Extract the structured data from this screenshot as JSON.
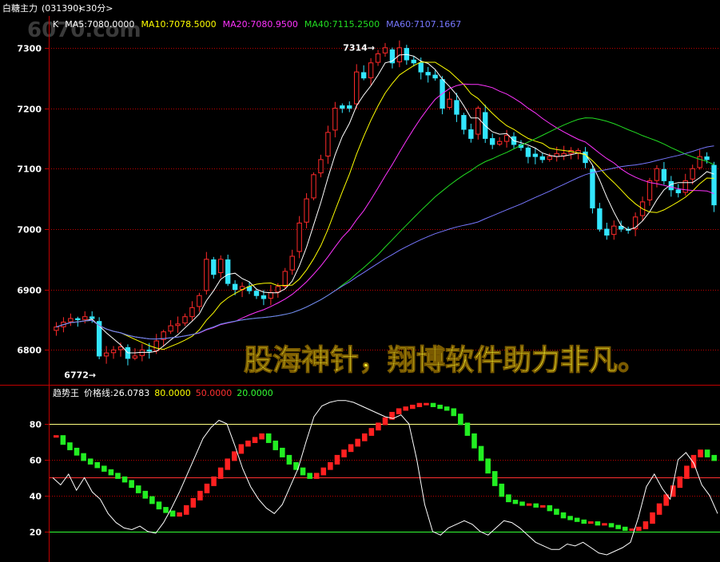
{
  "header": {
    "instrument": "白糖主力",
    "code": "(031390)",
    "period": "<30分>"
  },
  "watermark": "6070.com",
  "overlay_slogan": "股海神针，翔博软件助力非凡。",
  "colors": {
    "background": "#000000",
    "up": "#ff2a2a",
    "down": "#33e6ff",
    "grid": "#c00000",
    "ma5": "#ffffff",
    "ma10": "#ffff00",
    "ma20": "#ff33ff",
    "ma40": "#22dd22",
    "ma60": "#7777ff",
    "trend_up": "#ff2020",
    "trend_down": "#22ee22",
    "price_line": "#ffffff"
  },
  "chart_data": [
    {
      "type": "candlestick",
      "name": "K",
      "y_ticks": [
        7300,
        7200,
        7100,
        7000,
        6900,
        6800
      ],
      "ylim": [
        6745,
        7350
      ],
      "grid": true,
      "annotations": [
        {
          "text": "7314→",
          "bar": 45,
          "value": 7314
        },
        {
          "text": "6772→",
          "bar": 6,
          "value": 6772
        }
      ],
      "legend": [
        {
          "key": "K",
          "text": "K"
        },
        {
          "key": "ma5",
          "text": "MA5:7080.0000"
        },
        {
          "key": "ma10",
          "text": "MA10:7078.5000"
        },
        {
          "key": "ma20",
          "text": "MA20:7080.9500"
        },
        {
          "key": "ma40",
          "text": "MA40:7115.2500"
        },
        {
          "key": "ma60",
          "text": "MA60:7107.1667"
        }
      ],
      "closes": [
        6838,
        6846,
        6852,
        6850,
        6855,
        6852,
        6790,
        6795,
        6800,
        6805,
        6786,
        6790,
        6800,
        6798,
        6815,
        6830,
        6840,
        6843,
        6855,
        6870,
        6890,
        6950,
        6925,
        6950,
        6910,
        6900,
        6905,
        6898,
        6890,
        6885,
        6895,
        6905,
        6930,
        6955,
        7010,
        7050,
        7090,
        7115,
        7160,
        7200,
        7200,
        7200,
        7260,
        7250,
        7275,
        7290,
        7300,
        7275,
        7300,
        7280,
        7275,
        7260,
        7255,
        7250,
        7200,
        7215,
        7190,
        7165,
        7150,
        7200,
        7150,
        7140,
        7145,
        7155,
        7140,
        7135,
        7120,
        7120,
        7115,
        7120,
        7125,
        7125,
        7130,
        7130,
        7110,
        7035,
        7000,
        6990,
        7005,
        7000,
        6998,
        7020,
        7045,
        7080,
        7100,
        7080,
        7065,
        7060,
        7080,
        7100,
        7120,
        7115,
        7040
      ]
    },
    {
      "type": "line+bar",
      "name": "趋势王",
      "legend": [
        {
          "key": "name",
          "text": "趋势王"
        },
        {
          "key": "price",
          "text": "价格线:26.0783"
        },
        {
          "key": "l80",
          "text": "80.0000"
        },
        {
          "key": "l50",
          "text": "50.0000"
        },
        {
          "key": "l20",
          "text": "20.0000"
        }
      ],
      "y_ticks": [
        80,
        60,
        40,
        20
      ],
      "ylim": [
        3,
        100
      ],
      "levels": [
        80,
        50,
        20
      ],
      "trend_values": [
        73,
        69,
        66,
        63,
        60,
        58,
        56,
        54,
        52,
        50,
        48,
        45,
        42,
        39,
        36,
        33,
        31,
        29,
        30,
        34,
        38,
        42,
        46,
        50,
        55,
        60,
        64,
        68,
        70,
        72,
        74,
        70,
        66,
        62,
        58,
        55,
        52,
        50,
        52,
        55,
        58,
        62,
        65,
        68,
        71,
        74,
        77,
        80,
        83,
        86,
        88,
        89,
        90,
        91,
        91,
        90,
        89,
        88,
        85,
        80,
        74,
        67,
        60,
        53,
        46,
        40,
        37,
        36,
        35,
        35,
        34,
        34,
        32,
        30,
        28,
        27,
        26,
        25,
        25,
        24,
        24,
        23,
        22,
        21,
        21,
        22,
        25,
        30,
        35,
        40,
        45,
        50,
        56,
        62,
        65,
        62,
        60
      ],
      "price_line": [
        50,
        46,
        52,
        43,
        50,
        42,
        38,
        30,
        25,
        22,
        21,
        23,
        20,
        19,
        25,
        33,
        42,
        52,
        62,
        72,
        78,
        82,
        80,
        68,
        55,
        45,
        38,
        33,
        30,
        35,
        45,
        55,
        70,
        84,
        90,
        92,
        93,
        93,
        92,
        90,
        88,
        86,
        84,
        83,
        85,
        80,
        60,
        35,
        20,
        18,
        22,
        24,
        26,
        24,
        20,
        18,
        22,
        26,
        25,
        22,
        18,
        14,
        12,
        10,
        10,
        13,
        12,
        14,
        11,
        8,
        7,
        9,
        11,
        14,
        28,
        45,
        52,
        44,
        38,
        60,
        64,
        58,
        46,
        40,
        30
      ]
    }
  ]
}
